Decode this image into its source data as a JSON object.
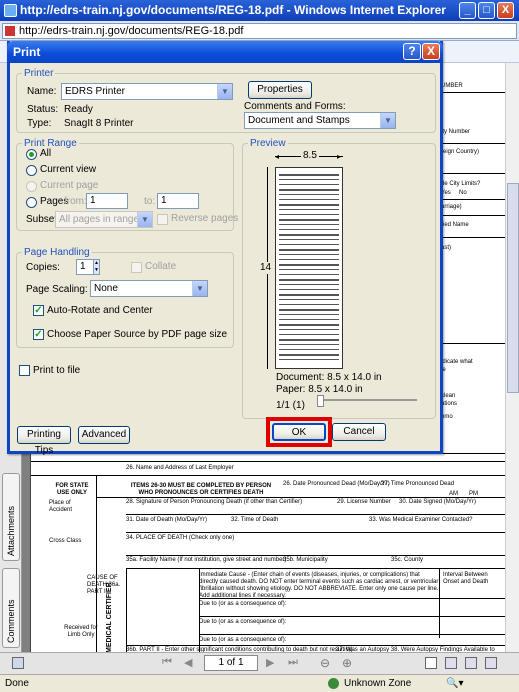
{
  "ie": {
    "window_title": "http://edrs-train.nj.gov/documents/REG-18.pdf - Windows Internet Explorer",
    "address": "http://edrs-train.nj.gov/documents/REG-18.pdf",
    "minimize": "_",
    "maximize": "□",
    "close": "X"
  },
  "dialog": {
    "title": "Print",
    "help": "?",
    "close": "X",
    "printer": {
      "group": "Printer",
      "name_label": "Name:",
      "name_value": "EDRS Printer",
      "properties_button": "Properties",
      "status_label": "Status:",
      "status_value": "Ready",
      "type_label": "Type:",
      "type_value": "SnagIt 8 Printer",
      "comments_label": "Comments and Forms:",
      "comments_value": "Document and Stamps"
    },
    "range": {
      "group": "Print Range",
      "all": "All",
      "current_view": "Current view",
      "current_page": "Current page",
      "pages": "Pages",
      "from_label": "from:",
      "from_value": "1",
      "to_label": "to:",
      "to_value": "1",
      "subset_label": "Subset:",
      "subset_value": "All pages in range",
      "reverse": "Reverse pages"
    },
    "handling": {
      "group": "Page Handling",
      "copies_label": "Copies:",
      "copies_value": "1",
      "collate": "Collate",
      "scaling_label": "Page Scaling:",
      "scaling_value": "None",
      "auto_rotate": "Auto-Rotate and Center",
      "choose_source": "Choose Paper Source by PDF page size"
    },
    "print_to_file": "Print to file",
    "preview": {
      "group": "Preview",
      "width": "8.5",
      "height": "14",
      "document": "Document: 8.5 x 14.0 in",
      "paper": "Paper: 8.5 x 14.0 in",
      "page_index": "1/1 (1)"
    },
    "buttons": {
      "printing_tips": "Printing Tips",
      "advanced": "Advanced",
      "ok": "OK",
      "cancel": "Cancel"
    }
  },
  "background_doc": {
    "right_fragments": [
      "UMBER",
      "ity Number",
      "reign Country)",
      "de City Limits?",
      "Yes",
      "No",
      "arriage)",
      "ried Name",
      "ast)",
      "idicate what",
      "ie",
      "clean",
      "ations",
      "omo"
    ],
    "state_only": "FOR STATE USE ONLY",
    "place_of_accident": "Place of Accident",
    "cross_class": "Cross Class",
    "received": "Received for Limb Only",
    "medical_certifier": "MEDICAL CERTIFIER",
    "row26": "26. Name and Address of Last Employer",
    "items_header": "ITEMS 26-30 MUST BE COMPLETED BY PERSON WHO PRONOUNCES OR CERTIFIES DEATH",
    "row26b": "26. Date Pronounced Dead (Mo/Day/Yr)",
    "row27": "27. Time Pronounced Dead",
    "row28": "28. Signature of Person Pronouncing Death (if other than Certifier)",
    "row29": "29. License Number",
    "row30": "30. Date Signed (Mo/Day/Yr)",
    "row31": "31. Date of Death (Mo/Day/Yr)",
    "row32": "32. Time of Death",
    "row33": "33. Was Medical Examiner Contacted?",
    "row34": "34. PLACE OF DEATH (Check only one)",
    "row35": "35a. Facility Name (If not institution, give street and number)",
    "row35b": "35b. Municipality",
    "row35c": "35c. County",
    "cause_title": "CAUSE OF DEATH 36a. PART I",
    "immediate": "Immediate Cause - (Enter chain of events (diseases, injuries, or complications) that directly caused death. DO NOT enter terminal events such as cardiac arrest, or ventricular fibrillation without showing etiology. DO NOT ABBREVIATE. Enter only one cause per line. Add additional lines if necessary.",
    "due_to": "Due to (or as a consequence of):",
    "interval": "Interval Between Onset and Death",
    "part2": "36b. PART II - Enter other significant conditions contributing to death but not resulting",
    "autopsy": "37. Was an Autopsy 38. Were Autopsy Findings Available to",
    "am": "AM",
    "pm": "PM"
  },
  "side_tabs": [
    "Attachments",
    "Comments"
  ],
  "pdf_nav": {
    "page_box": "1 of 1"
  },
  "status": {
    "left": "Done",
    "zone": "Unknown Zone"
  }
}
